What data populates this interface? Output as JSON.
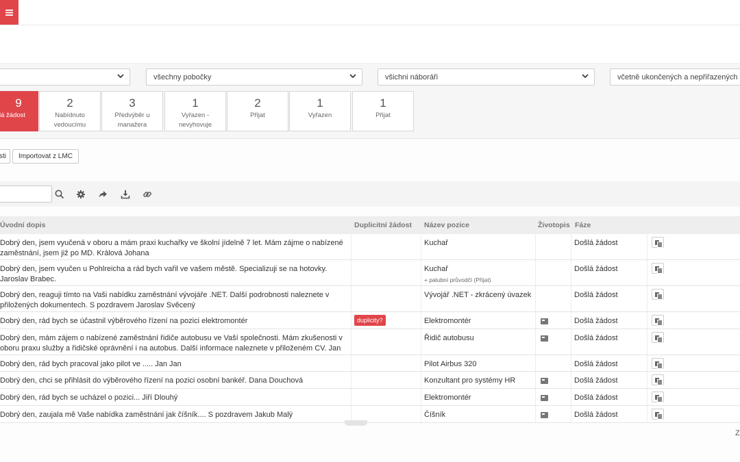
{
  "filters": {
    "first": "",
    "branches": "všechny pobočky",
    "recruiters": "všichni náboráři",
    "status": "včetně ukončených a nepřiřazených"
  },
  "stages": [
    {
      "count": "9",
      "label": "lá žádost",
      "active": true
    },
    {
      "count": "2",
      "label": "Nabídnuto vedoucímu"
    },
    {
      "count": "3",
      "label": "Předvýběr u manažera"
    },
    {
      "count": "1",
      "label": "Vyřazen - nevyhovuje"
    },
    {
      "count": "2",
      "label": "Přijat"
    },
    {
      "count": "1",
      "label": "Vyřazen"
    },
    {
      "count": "1",
      "label": "Přijat"
    }
  ],
  "actions": {
    "left_button": "sti",
    "import_button": "Importovat z LMC"
  },
  "toolbar": {
    "icons": [
      "search-icon",
      "gear-icon",
      "share-icon",
      "download-icon",
      "link-icon"
    ]
  },
  "table": {
    "headers": {
      "cover_letter": "Úvodní dopis",
      "duplicate": "Duplicitní žádost",
      "position": "Název pozice",
      "cv": "Životopis",
      "phase": "Fáze"
    },
    "rows": [
      {
        "letter": "Dobrý den, jsem vyučená v oboru a mám praxi kuchařky ve školní jídelně 7 let. Mám zájme o nabízené zaměstnání, jsem již po MD. Králová Johana",
        "duplicate": "",
        "position": "Kuchař",
        "position_sub": "",
        "cv": false,
        "phase": "Došlá žádost"
      },
      {
        "letter": "Dobrý den, jsem vyučen u Pohlreicha a rád bych vařil ve vašem městě. Specializuji se na hotovky. Jaroslav Brabec.",
        "duplicate": "",
        "position": "Kuchař",
        "position_sub": "+ palubní průvodčí (Přijat)",
        "cv": false,
        "phase": "Došlá žádost"
      },
      {
        "letter": "Dobrý den, reaguji tímto na Vaši nabídku zaměstnání vývojáře .NET. Další podrobnosti naleznete v přiložených dokumentech. S pozdravem Jaroslav Svěcený",
        "duplicate": "",
        "position": "Vývojář .NET - zkrácený úvazek",
        "position_sub": "",
        "cv": false,
        "phase": "Došlá žádost"
      },
      {
        "letter": "Dobrý den, rád bych se účastnil výběrového řízení na pozici elektromontér",
        "duplicate": "duplicity?",
        "position": "Elektromontér",
        "position_sub": "",
        "cv": true,
        "phase": "Došlá žádost"
      },
      {
        "letter": "Dobrý den, mám zájem o nabízené zaměstnání řidiče autobusu ve Vaší společnosti. Mám zkušenosti v oboru praxu služby a řidičské oprávnění i na autobus. Další informace naleznete v přiloženém CV. Jan Hrubý",
        "duplicate": "",
        "position": "Řidič autobusu",
        "position_sub": "",
        "cv": true,
        "phase": "Došlá žádost"
      },
      {
        "letter": "Dobrý den, rád bych pracoval jako pilot ve ..... Jan Jan",
        "duplicate": "",
        "position": "Pilot Airbus 320",
        "position_sub": "",
        "cv": false,
        "phase": "Došlá žádost"
      },
      {
        "letter": "Dobrý den, chci se přihlásit do výběrového řízení na pozici osobní bankéř. Dana Douchová",
        "duplicate": "",
        "position": "Konzultant pro systémy HR",
        "position_sub": "",
        "cv": true,
        "phase": "Došlá žádost"
      },
      {
        "letter": "Dobrý den, rád bych se ucházel o pozici... Jiří Dlouhý",
        "duplicate": "",
        "position": "Elektromontér",
        "position_sub": "",
        "cv": true,
        "phase": "Došlá žádost"
      },
      {
        "letter": "Dobrý den, zaujala mě Vaše nabídka zaměstnání jak číšník.... S pozdravem Jakub Malý",
        "duplicate": "",
        "position": "Číšník",
        "position_sub": "",
        "cv": true,
        "phase": "Došlá žádost"
      }
    ]
  },
  "footer": {
    "text": "Z"
  },
  "colors": {
    "accent": "#e0454a"
  }
}
